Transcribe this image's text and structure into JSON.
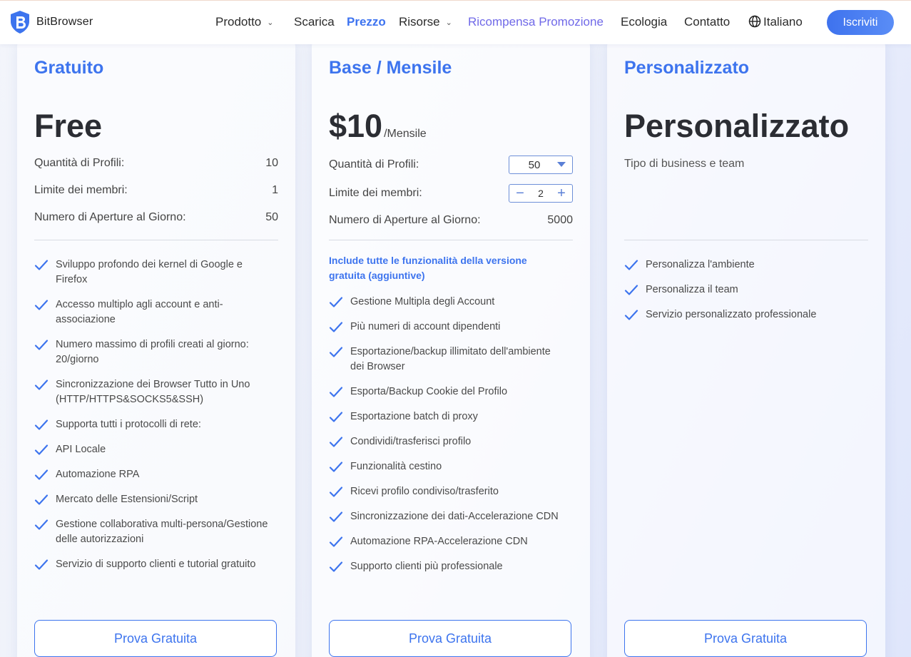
{
  "nav": {
    "brand": "BitBrowser",
    "items": [
      {
        "label": "Prodotto"
      },
      {
        "label": "Scarica"
      },
      {
        "label": "Prezzo"
      },
      {
        "label": "Risorse"
      },
      {
        "label": "Ricompensa Promozione"
      },
      {
        "label": "Ecologia"
      },
      {
        "label": "Contatto"
      },
      {
        "label": "Italiano"
      }
    ],
    "signup": "Iscriviti"
  },
  "colors": {
    "accent": "#3d74ee",
    "promo": "#7069e8",
    "text": "#2b2d33"
  },
  "plans": [
    {
      "name": "Gratuito",
      "price": "Free",
      "rows": [
        {
          "label": "Quantità di Profili:",
          "value": "10"
        },
        {
          "label": "Limite dei membri:",
          "value": "1"
        },
        {
          "label": "Numero di Aperture al Giorno:",
          "value": "50"
        }
      ],
      "features": [
        "Sviluppo profondo dei kernel di Google e Firefox",
        "Accesso multiplo agli account e anti-associazione",
        "Numero massimo di profili creati al giorno: 20/giorno",
        "Sincronizzazione dei Browser Tutto in Uno (HTTP/HTTPS&SOCKS5&SSH)",
        "Supporta tutti i protocolli di rete:",
        "API Locale",
        "Automazione RPA",
        "Mercato delle Estensioni/Script",
        "Gestione collaborativa multi-persona/Gestione delle autorizzazioni",
        "Servizio di supporto clienti e tutorial gratuito"
      ],
      "cta": "Prova Gratuita"
    },
    {
      "name": "Base / Mensile",
      "price": "$10",
      "price_suffix": "/Mensile",
      "rows": [
        {
          "label": "Quantità di Profili:",
          "value": "50"
        },
        {
          "label": "Limite dei membri:",
          "value": "2"
        },
        {
          "label": "Numero di Aperture al Giorno:",
          "value": "5000"
        }
      ],
      "includes": "Include tutte le funzionalità della versione gratuita (aggiuntive)",
      "features": [
        "Gestione Multipla degli Account",
        "Più numeri di account dipendenti",
        "Esportazione/backup illimitato dell'ambiente dei Browser",
        "Esporta/Backup Cookie del Profilo",
        "Esportazione batch di proxy",
        "Condividi/trasferisci profilo",
        "Funzionalità cestino",
        "Ricevi profilo condiviso/trasferito",
        "Sincronizzazione dei dati-Accelerazione CDN",
        "Automazione RPA-Accelerazione CDN",
        "Supporto clienti più professionale"
      ],
      "cta": "Prova Gratuita"
    },
    {
      "name": "Personalizzato",
      "price": "Personalizzato",
      "subtitle": "Tipo di business e team",
      "features": [
        "Personalizza l'ambiente",
        "Personalizza il team",
        "Servizio personalizzato professionale"
      ],
      "cta": "Prova Gratuita"
    }
  ]
}
